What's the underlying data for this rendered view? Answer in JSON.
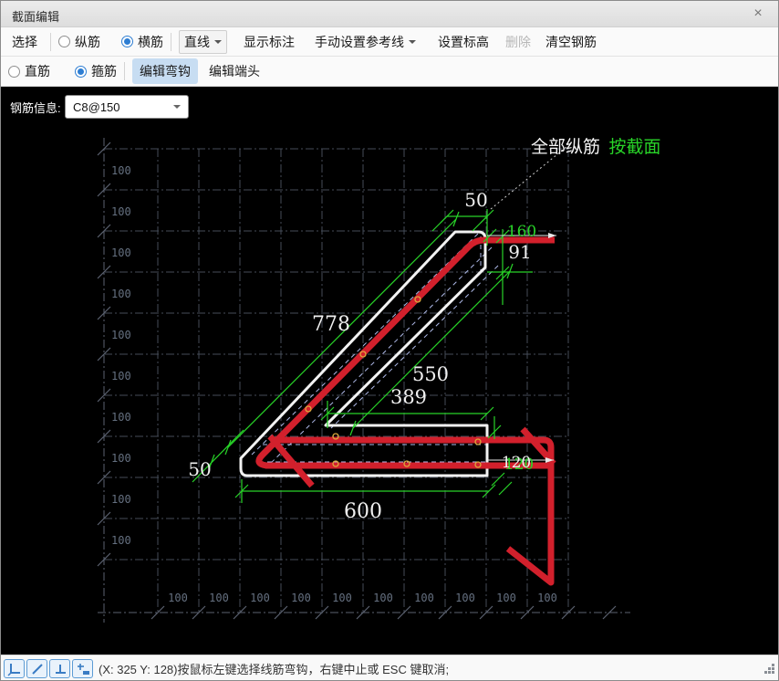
{
  "window": {
    "title": "截面编辑",
    "close_glyph": "×"
  },
  "toolbar1": {
    "select": "选择",
    "longitudinal": "纵筋",
    "transverse": "横筋",
    "line": "直线",
    "show_annotation": "显示标注",
    "manual_reference": "手动设置参考线",
    "set_elevation": "设置标高",
    "delete": "删除",
    "clear_rebar": "清空钢筋"
  },
  "toolbar2": {
    "straight": "直筋",
    "stirrup": "箍筋",
    "edit_hook": "编辑弯钩",
    "edit_end": "编辑端头"
  },
  "rebar_info": {
    "label": "钢筋信息:",
    "value": "C8@150"
  },
  "canvas": {
    "ruler_unit": "100",
    "labels": {
      "all_longitudinal": "全部纵筋",
      "by_section": "按截面"
    },
    "dims": {
      "top_50": "50",
      "green_160": "160",
      "right_91": "91",
      "diag_778": "778",
      "diag_550": "550",
      "mid_389": "389",
      "right_120": "120",
      "left_50": "50",
      "bottom_600": "600"
    }
  },
  "statusbar": {
    "message": "(X: 325 Y: 128)按鼠标左键选择线筋弯钩，右键中止或 ESC 键取消;",
    "icons": [
      "axis-corner-icon",
      "diagonal-line-icon",
      "perpendicular-icon",
      "offset-point-icon"
    ]
  },
  "colors": {
    "rebar_red": "#d2202c",
    "dim_green": "#28d428",
    "outline_white": "#f2f2f2",
    "reference_dash": "#aeb9e8",
    "marker_yellow": "#dda83c",
    "accent_blue": "#2d7dd2",
    "canvas_bg": "#000000"
  }
}
